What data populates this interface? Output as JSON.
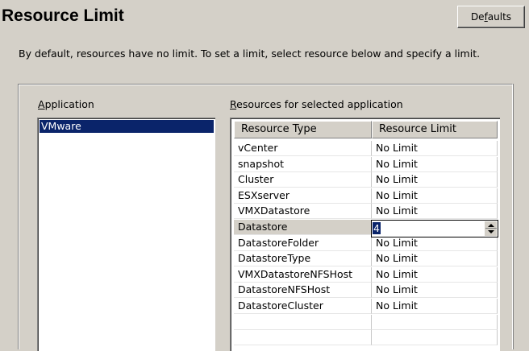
{
  "page": {
    "title": "Resource Limit",
    "defaults_button": {
      "before": "De",
      "accel": "f",
      "after": "aults"
    },
    "description": "By default, resources have no limit. To set a limit, select resource below and specify a limit."
  },
  "application_panel": {
    "label": {
      "accel": "A",
      "rest": "pplication"
    },
    "items": [
      "VMware"
    ],
    "selected": "VMware"
  },
  "resources_panel": {
    "label": {
      "accel": "R",
      "rest": "esources for selected application"
    },
    "columns": [
      "Resource Type",
      "Resource Limit"
    ],
    "rows": [
      {
        "type": "vCenter",
        "limit": "No Limit"
      },
      {
        "type": "snapshot",
        "limit": "No Limit"
      },
      {
        "type": "Cluster",
        "limit": "No Limit"
      },
      {
        "type": "ESXserver",
        "limit": "No Limit"
      },
      {
        "type": "VMXDatastore",
        "limit": "No Limit"
      },
      {
        "type": "Datastore",
        "limit": "4"
      },
      {
        "type": "DatastoreFolder",
        "limit": "No Limit"
      },
      {
        "type": "DatastoreType",
        "limit": "No Limit"
      },
      {
        "type": "VMXDatastoreNFSHost",
        "limit": "No Limit"
      },
      {
        "type": "DatastoreNFSHost",
        "limit": "No Limit"
      },
      {
        "type": "DatastoreCluster",
        "limit": "No Limit"
      }
    ],
    "editing_row": "Datastore",
    "spinner_value": "4"
  }
}
